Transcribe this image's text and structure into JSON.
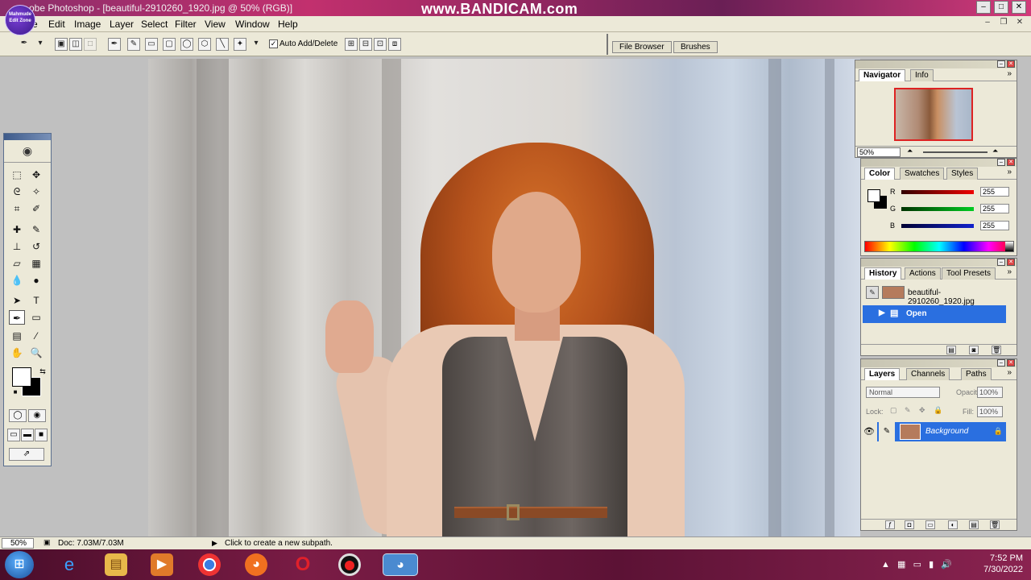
{
  "app": {
    "title": "Adobe Photoshop - [beautiful-2910260_1920.jpg @ 50% (RGB)]",
    "title_visible": "obe Photoshop - [beautiful-2910260_1920.jpg @ 50% (RGB)]",
    "watermark": "www.BANDICAM.com",
    "channel_logo": "Mahmude Edit Zone"
  },
  "menu": [
    "e",
    "Edit",
    "Image",
    "Layer",
    "Select",
    "Filter",
    "View",
    "Window",
    "Help"
  ],
  "options": {
    "auto_add_delete_label": "Auto Add/Delete",
    "auto_add_delete_checked": true,
    "well_tabs": [
      "File Browser",
      "Brushes"
    ]
  },
  "navigator": {
    "tabs": [
      "Navigator",
      "Info"
    ],
    "zoom": "50%"
  },
  "color": {
    "tabs": [
      "Color",
      "Swatches",
      "Styles"
    ],
    "channels": [
      {
        "label": "R",
        "value": "255",
        "color": "#cc1111"
      },
      {
        "label": "G",
        "value": "255",
        "color": "#11aa22"
      },
      {
        "label": "B",
        "value": "255",
        "color": "#1122cc"
      }
    ]
  },
  "history": {
    "tabs": [
      "History",
      "Actions",
      "Tool Presets"
    ],
    "snapshot": "beautiful-2910260_1920.jpg",
    "state": "Open"
  },
  "layers": {
    "tabs": [
      "Layers",
      "Channels",
      "Paths"
    ],
    "blend_mode": "Normal",
    "opacity_label": "Opacity:",
    "opacity": "100%",
    "fill_label": "Fill:",
    "fill": "100%",
    "lock_label": "Lock:",
    "layer_name": "Background"
  },
  "status": {
    "zoom": "50%",
    "doc": "Doc: 7.03M/7.03M",
    "hint": "Click to create a new subpath."
  },
  "taskbar": {
    "time": "7:52 PM",
    "date": "7/30/2022"
  }
}
